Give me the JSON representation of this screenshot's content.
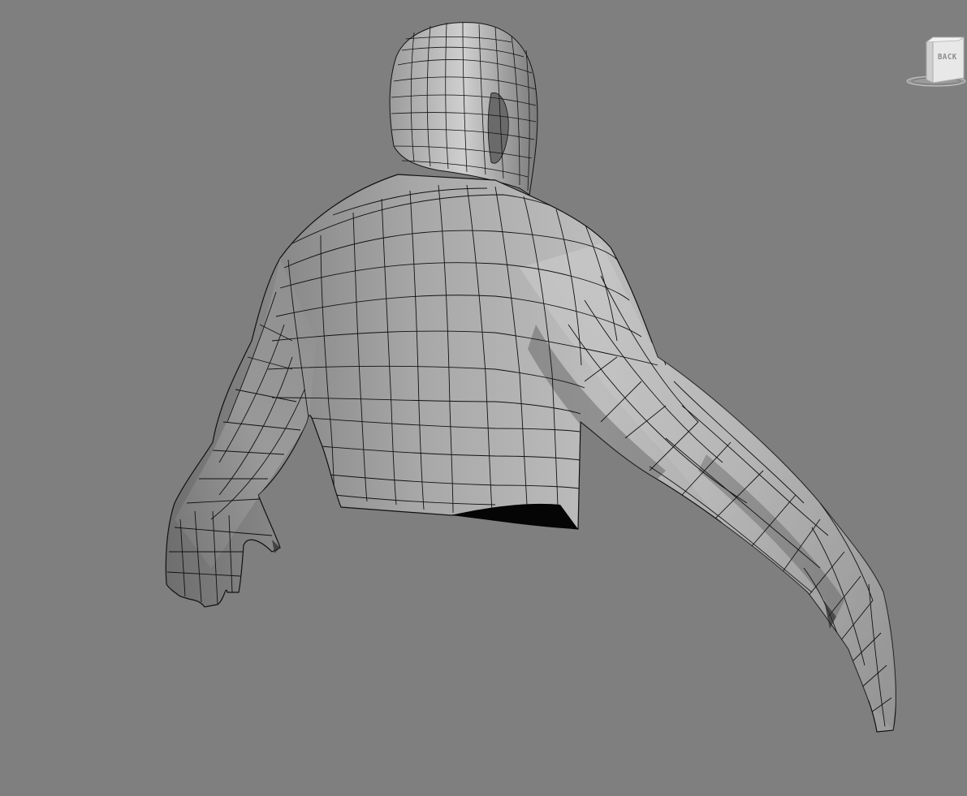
{
  "viewport": {
    "background_color": "#7f7f7f",
    "mesh_fill_light": "#d0d0d0",
    "mesh_fill_dark": "#5a5a5a",
    "wire_color": "#111111"
  },
  "viewcube": {
    "face_label": "BACK"
  }
}
